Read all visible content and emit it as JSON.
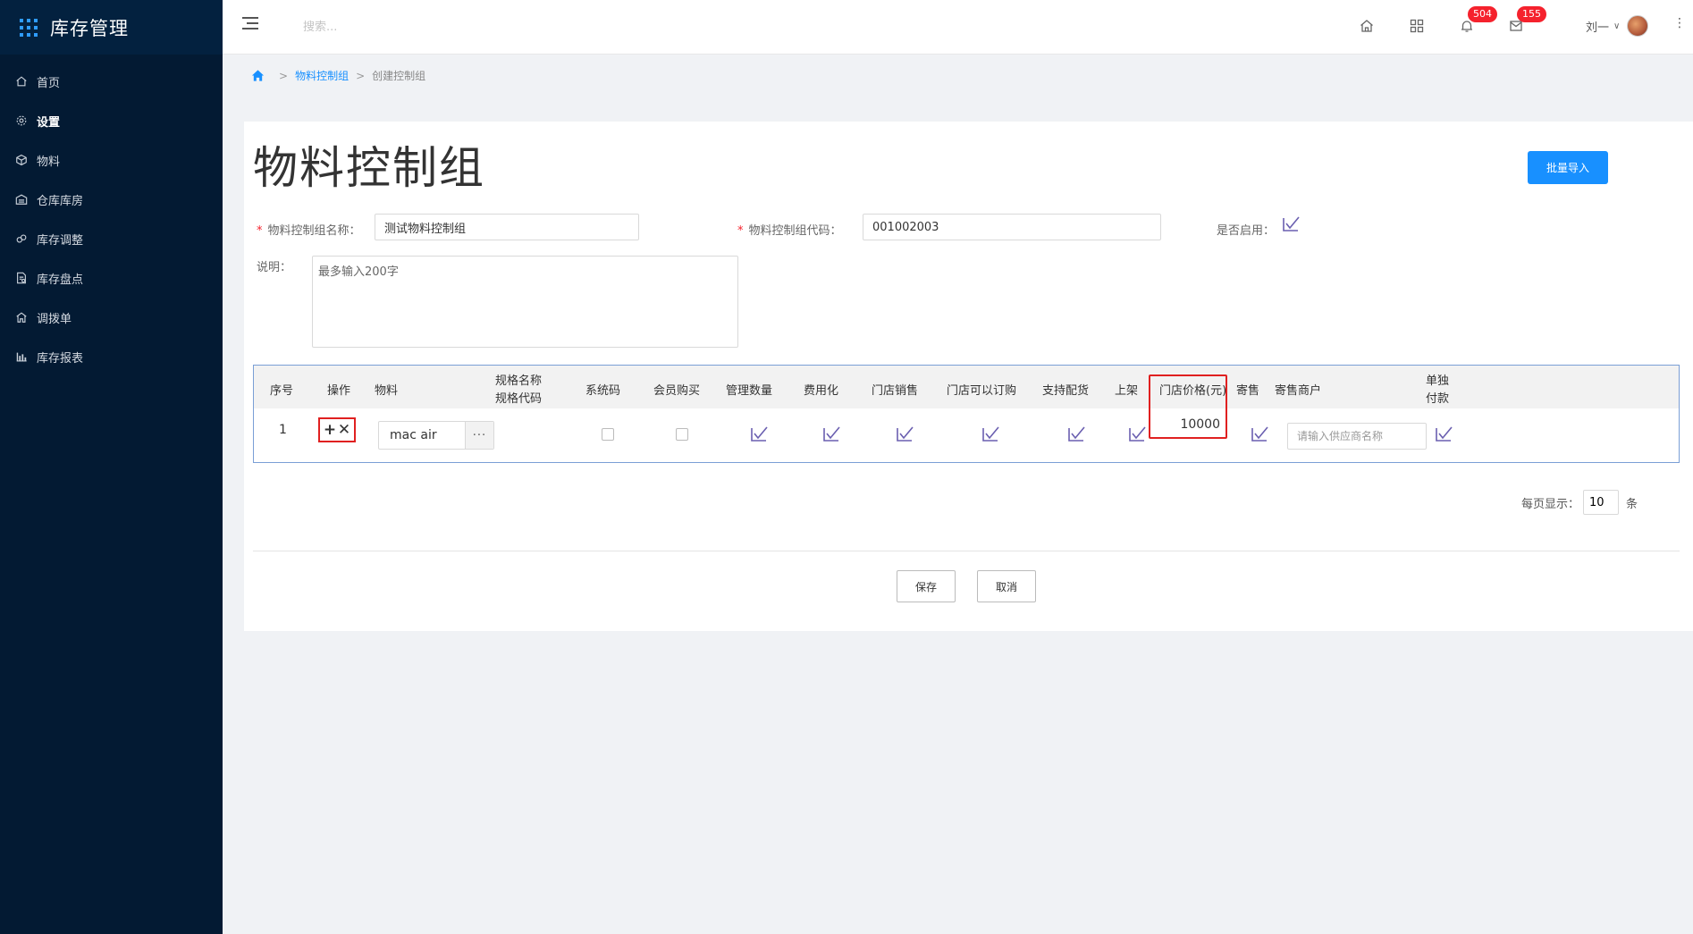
{
  "app": {
    "title": "库存管理"
  },
  "sidebar": {
    "items": [
      {
        "label": "首页",
        "icon": "home-icon"
      },
      {
        "label": "设置",
        "icon": "gear-icon",
        "active": true
      },
      {
        "label": "物料",
        "icon": "cube-icon"
      },
      {
        "label": "仓库库房",
        "icon": "warehouse-icon"
      },
      {
        "label": "库存调整",
        "icon": "adjust-icon"
      },
      {
        "label": "库存盘点",
        "icon": "inventory-icon"
      },
      {
        "label": "调拨单",
        "icon": "transfer-icon"
      },
      {
        "label": "库存报表",
        "icon": "bar-chart-icon"
      }
    ]
  },
  "topbar": {
    "search_placeholder": "搜索...",
    "notifications_count": "504",
    "messages_count": "155",
    "user_name": "刘一"
  },
  "breadcrumb": {
    "parent": "物料控制组",
    "current": "创建控制组"
  },
  "page": {
    "title": "物料控制组",
    "import_button": "批量导入",
    "name_label": "物料控制组名称：",
    "name_value": "测试物料控制组",
    "code_label": "物料控制组代码：",
    "code_value": "001002003",
    "enabled_label": "是否启用：",
    "desc_label": "说明：",
    "desc_placeholder": "最多输入200字"
  },
  "table": {
    "headers": {
      "seq": "序号",
      "ops": "操作",
      "material": "物料",
      "spec_name": "规格名称",
      "spec_code": "规格代码",
      "system_code": "系统码",
      "member_buy": "会员购买",
      "manage_qty": "管理数量",
      "expense": "费用化",
      "store_sale": "门店销售",
      "store_order": "门店可以订购",
      "delivery": "支持配货",
      "listed": "上架",
      "store_price": "门店价格(元)",
      "consign": "寄售",
      "consign_vendor": "寄售商户",
      "separate_pay_1": "单独",
      "separate_pay_2": "付款"
    },
    "row": {
      "seq": "1",
      "material": "mac  air",
      "more": "···",
      "store_price": "10000",
      "vendor_placeholder": "请输入供应商名称"
    }
  },
  "pager": {
    "label": "每页显示：",
    "value": "10",
    "unit": "条"
  },
  "actions": {
    "save": "保存",
    "cancel": "取消"
  },
  "colors": {
    "sidebar": "#031a33",
    "primary": "#1890ff",
    "highlight": "#e02020",
    "badge": "#f5222d",
    "check": "#6a5fb0"
  }
}
